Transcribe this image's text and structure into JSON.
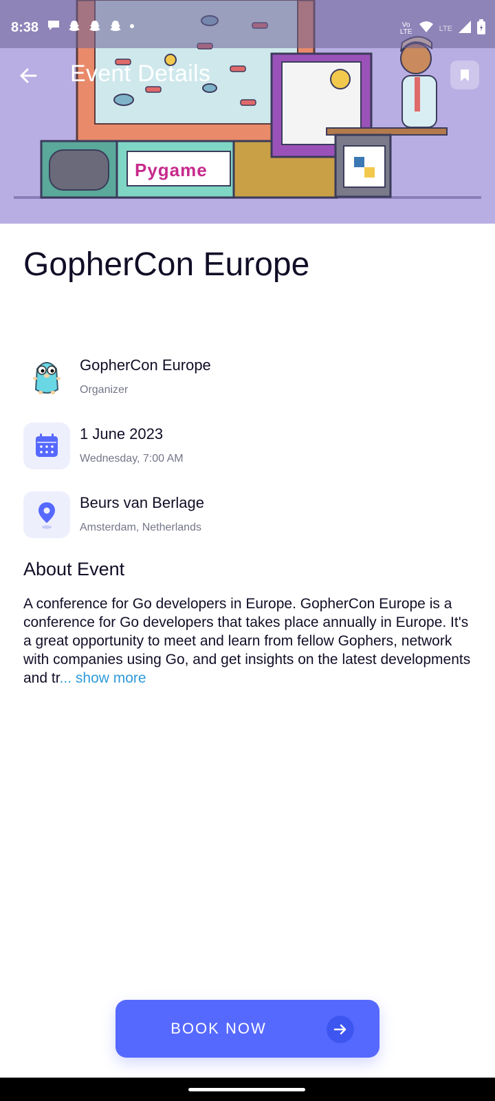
{
  "status_bar": {
    "time": "8:38",
    "left_icons": [
      "chat-icon",
      "snapchat-icon",
      "snapchat-icon",
      "snapchat-icon",
      "dot-icon"
    ],
    "right_icons": [
      "volte-icon",
      "wifi-icon",
      "lte-icon",
      "signal-icon",
      "battery-icon"
    ],
    "volte_label": "VoLTE",
    "lte_label": "LTE"
  },
  "app_bar": {
    "title": "Event Details",
    "back_icon": "arrow-left-icon",
    "bookmark_icon": "bookmark-icon"
  },
  "hero": {
    "banner_text": "Pygame",
    "image_description_icon": "python-logo-icon"
  },
  "event": {
    "title": "GopherCon Europe",
    "organizer": {
      "name": "GopherCon Europe",
      "role": "Organizer",
      "icon": "gopher-icon"
    },
    "date": {
      "main": "1 June 2023",
      "sub": "Wednesday, 7:00 AM",
      "icon": "calendar-icon"
    },
    "location": {
      "main": "Beurs van Berlage",
      "sub": "Amsterdam, Netherlands",
      "icon": "location-pin-icon"
    }
  },
  "about": {
    "heading": "About Event",
    "text": "A conference for Go developers in Europe. GopherCon Europe is a conference for Go developers that takes place annually in Europe. It's a great opportunity to meet and learn from fellow Gophers, network with companies using Go, and get insights on the latest developments and tr",
    "show_more": "... show more"
  },
  "book_button": {
    "label": "BOOK NOW",
    "icon": "arrow-right-icon"
  },
  "colors": {
    "primary": "#5669ff",
    "icon_bg": "#eeeffd",
    "link": "#2f9bd9",
    "hero_bg": "#b9aee3"
  }
}
